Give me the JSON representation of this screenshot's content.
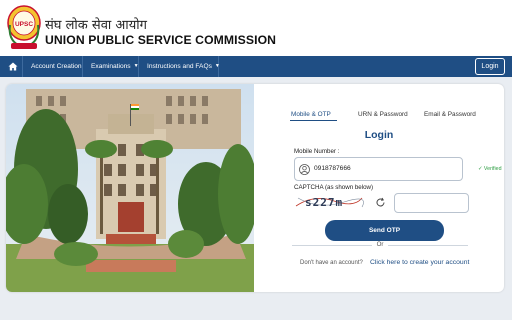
{
  "header": {
    "hindi_title": "संघ लोक सेवा आयोग",
    "english_title": "UNION PUBLIC SERVICE COMMISSION",
    "emblem_text": "UPSC"
  },
  "nav": {
    "items": [
      {
        "label": "Account Creation",
        "has_dropdown": false
      },
      {
        "label": "Examinations",
        "has_dropdown": true
      },
      {
        "label": "Instructions and FAQs",
        "has_dropdown": true
      }
    ],
    "login_label": "Login"
  },
  "login": {
    "tabs": [
      {
        "label": "Mobile & OTP",
        "active": true
      },
      {
        "label": "URN & Password",
        "active": false
      },
      {
        "label": "Email & Password",
        "active": false
      }
    ],
    "title": "Login",
    "mobile_label": "Mobile Number :",
    "mobile_value": "0918787666",
    "verified_text": "✓ Verified",
    "captcha_label": "CAPTCHA (as shown below)",
    "captcha_text": "s227m",
    "captcha_input_value": "",
    "send_otp_label": "Send OTP",
    "or_text": "Or",
    "no_account_text": "Don't have an account?",
    "create_account_link": "Click here to create your account"
  },
  "colors": {
    "primary": "#1f4e84",
    "verified": "#2f9e44",
    "background": "#e9edf2"
  }
}
